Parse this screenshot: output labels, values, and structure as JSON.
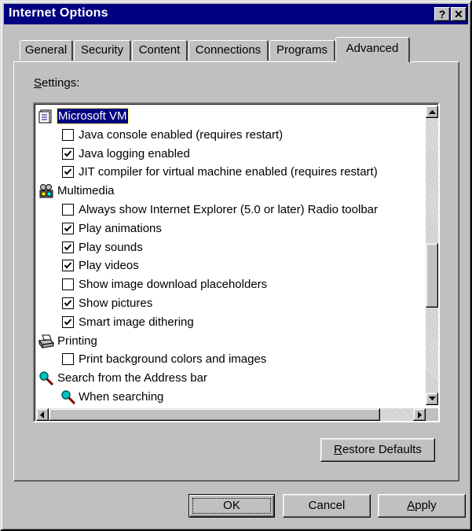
{
  "window": {
    "title": "Internet Options",
    "help_button": "?",
    "close_button": "✕"
  },
  "tabs": [
    {
      "label": "General",
      "active": false
    },
    {
      "label": "Security",
      "active": false
    },
    {
      "label": "Content",
      "active": false
    },
    {
      "label": "Connections",
      "active": false
    },
    {
      "label": "Programs",
      "active": false
    },
    {
      "label": "Advanced",
      "active": true
    }
  ],
  "settings": {
    "label_accel": "S",
    "label_rest": "ettings:",
    "rows": [
      {
        "type": "category",
        "label": "Microsoft VM",
        "icon": "document-icon",
        "selected": true
      },
      {
        "type": "checkbox",
        "label": "Java console enabled (requires restart)",
        "checked": false
      },
      {
        "type": "checkbox",
        "label": "Java logging enabled",
        "checked": true
      },
      {
        "type": "checkbox",
        "label": "JIT compiler for virtual machine enabled (requires restart)",
        "checked": true
      },
      {
        "type": "category",
        "label": "Multimedia",
        "icon": "multimedia-icon",
        "selected": false
      },
      {
        "type": "checkbox",
        "label": "Always show Internet Explorer (5.0 or later) Radio toolbar",
        "checked": false
      },
      {
        "type": "checkbox",
        "label": "Play animations",
        "checked": true
      },
      {
        "type": "checkbox",
        "label": "Play sounds",
        "checked": true
      },
      {
        "type": "checkbox",
        "label": "Play videos",
        "checked": true
      },
      {
        "type": "checkbox",
        "label": "Show image download placeholders",
        "checked": false
      },
      {
        "type": "checkbox",
        "label": "Show pictures",
        "checked": true
      },
      {
        "type": "checkbox",
        "label": "Smart image dithering",
        "checked": true
      },
      {
        "type": "category",
        "label": "Printing",
        "icon": "printer-icon",
        "selected": false
      },
      {
        "type": "checkbox",
        "label": "Print background colors and images",
        "checked": false
      },
      {
        "type": "category",
        "label": "Search from the Address bar",
        "icon": "search-icon",
        "selected": false
      },
      {
        "type": "subcategory",
        "label": "When searching",
        "icon": "search-icon"
      }
    ]
  },
  "buttons": {
    "restore_accel": "R",
    "restore_rest": "estore Defaults",
    "ok": "OK",
    "cancel": "Cancel",
    "apply_accel": "A",
    "apply_rest": "pply"
  },
  "colors": {
    "titlebar": "#000080",
    "face": "#c0c0c0",
    "selection": "#000080"
  }
}
